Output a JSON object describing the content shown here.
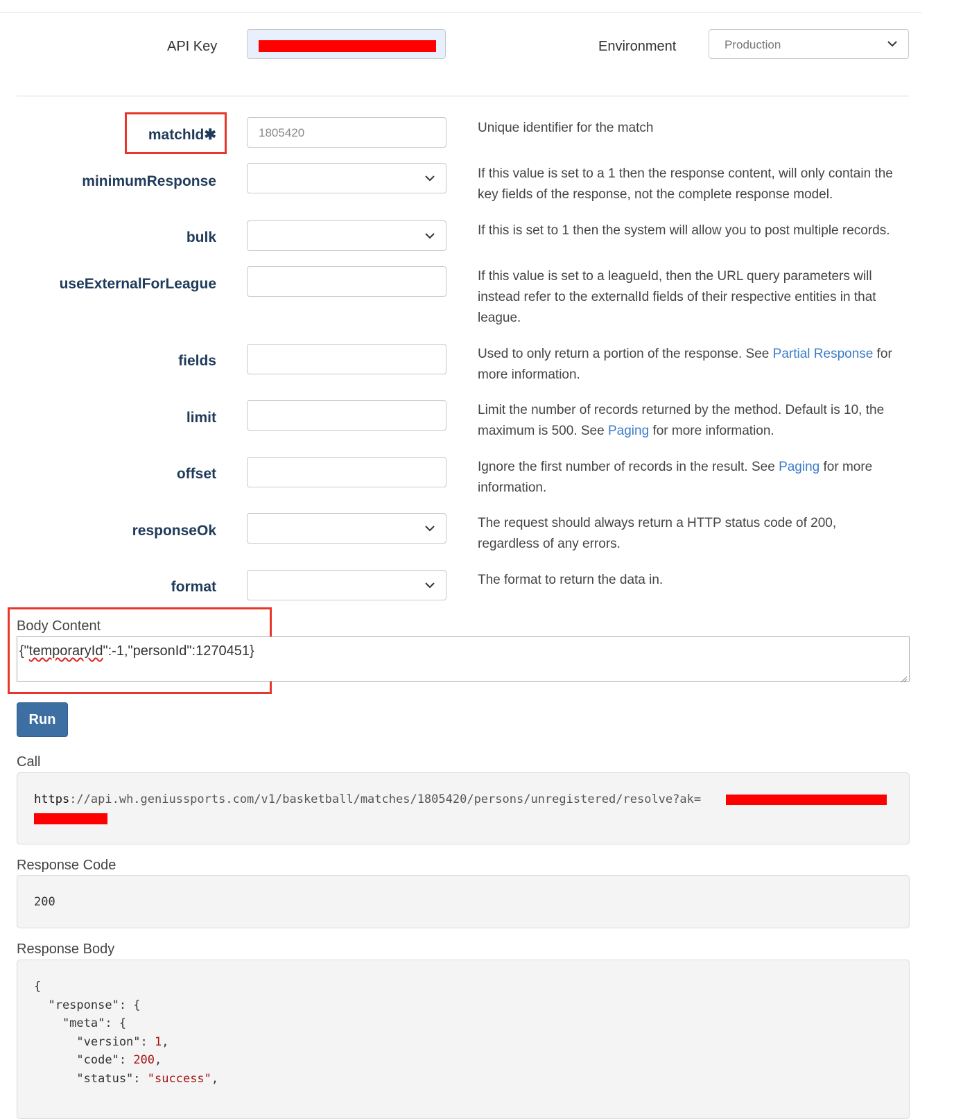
{
  "auth": {
    "api_key_label": "API Key",
    "environment_label": "Environment",
    "environment_value": "Production"
  },
  "params": [
    {
      "name": "matchId",
      "required_mark": "✱",
      "value": "1805420",
      "type": "text",
      "description": "Unique identifier for the match"
    },
    {
      "name": "minimumResponse",
      "value": "",
      "type": "select",
      "description": "If this value is set to a 1 then the response content, will only contain the key fields of the response, not the complete response model."
    },
    {
      "name": "bulk",
      "value": "",
      "type": "select",
      "description": "If this is set to 1 then the system will allow you to post multiple records."
    },
    {
      "name": "useExternalForLeague",
      "value": "",
      "type": "text",
      "description": "If this value is set to a leagueId, then the URL query parameters will instead refer to the externalId fields of their respective entities in that league."
    },
    {
      "name": "fields",
      "value": "",
      "type": "text",
      "description_pre": "Used to only return a portion of the response. See ",
      "description_link": "Partial Response",
      "description_post": " for more information."
    },
    {
      "name": "limit",
      "value": "",
      "type": "text",
      "description_pre": "Limit the number of records returned by the method. Default is 10, the maximum is 500. See ",
      "description_link": "Paging",
      "description_post": " for more information."
    },
    {
      "name": "offset",
      "value": "",
      "type": "text",
      "description_pre": "Ignore the first number of records in the result. See ",
      "description_link": "Paging",
      "description_post": " for more information."
    },
    {
      "name": "responseOk",
      "value": "",
      "type": "select",
      "description": "The request should always return a HTTP status code of 200, regardless of any errors."
    },
    {
      "name": "format",
      "value": "",
      "type": "select",
      "description": "The format to return the data in."
    }
  ],
  "body_content": {
    "label": "Body Content",
    "value_pre": "{\"",
    "value_squiggle": "temporaryId",
    "value_post": "\":-1,\"personId\":1270451}"
  },
  "run_button": "Run",
  "call": {
    "label": "Call",
    "url_scheme": "https",
    "url_rest": "://api.wh.geniussports.com/v1/basketball/matches/1805420/persons/unregistered/resolve?ak="
  },
  "response_code": {
    "label": "Response Code",
    "value": "200"
  },
  "response_body": {
    "label": "Response Body",
    "line1": "{",
    "line2_key": "  \"response\"",
    "line2_rest": ": {",
    "line3_key": "    \"meta\"",
    "line3_rest": ": {",
    "line4_key": "      \"version\"",
    "line4_sep": ": ",
    "line4_val": "1",
    "line4_end": ",",
    "line5_key": "      \"code\"",
    "line5_sep": ": ",
    "line5_val": "200",
    "line5_end": ",",
    "line6_key": "      \"status\"",
    "line6_sep": ": ",
    "line6_val": "\"success\"",
    "line6_end": ","
  },
  "colors": {
    "label_navy": "#1f3a5a",
    "link_blue": "#3a7bc8",
    "run_button": "#3d6fa3",
    "highlight_red": "#e8372a",
    "redaction": "#ff0000"
  }
}
